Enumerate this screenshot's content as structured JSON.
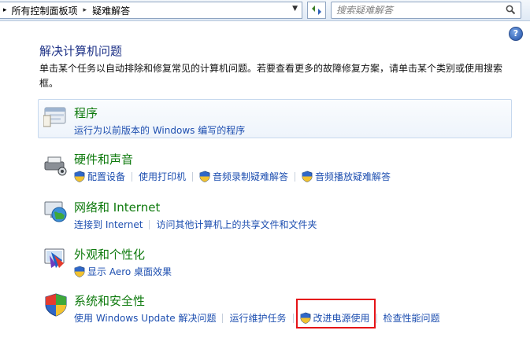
{
  "address_bar": {
    "breadcrumbs": [
      "所有控制面板项",
      "疑难解答"
    ],
    "search_placeholder": "搜索疑难解答"
  },
  "page": {
    "title": "解决计算机问题",
    "description": "单击某个任务以自动排除和修复常见的计算机问题。若要查看更多的故障修复方案，请单击某个类别或使用搜索框。"
  },
  "categories": [
    {
      "name": "程序",
      "icon": "programs-icon",
      "selected": true,
      "links": [
        {
          "label": "运行为以前版本的 Windows 编写的程序",
          "shield": false
        }
      ]
    },
    {
      "name": "硬件和声音",
      "icon": "hardware-sound-icon",
      "links": [
        {
          "label": "配置设备",
          "shield": true
        },
        {
          "label": "使用打印机",
          "shield": false
        },
        {
          "label": "音频录制疑难解答",
          "shield": true
        },
        {
          "label": "音频播放疑难解答",
          "shield": true
        }
      ]
    },
    {
      "name": "网络和 Internet",
      "icon": "network-globe-icon",
      "links": [
        {
          "label": "连接到 Internet",
          "shield": false
        },
        {
          "label": "访问其他计算机上的共享文件和文件夹",
          "shield": false
        }
      ]
    },
    {
      "name": "外观和个性化",
      "icon": "appearance-icon",
      "links": [
        {
          "label": "显示 Aero 桌面效果",
          "shield": true
        }
      ]
    },
    {
      "name": "系统和安全性",
      "icon": "security-shield-icon",
      "links": [
        {
          "label": "使用 Windows Update 解决问题",
          "shield": false
        },
        {
          "label": "运行维护任务",
          "shield": false
        },
        {
          "label": "改进电源使用",
          "shield": true
        },
        {
          "label": "检查性能问题",
          "shield": false
        }
      ]
    }
  ],
  "colors": {
    "category_title": "#0e7a0d",
    "link": "#1e4fb0",
    "highlight": "#e51317",
    "title": "#1e3287"
  }
}
